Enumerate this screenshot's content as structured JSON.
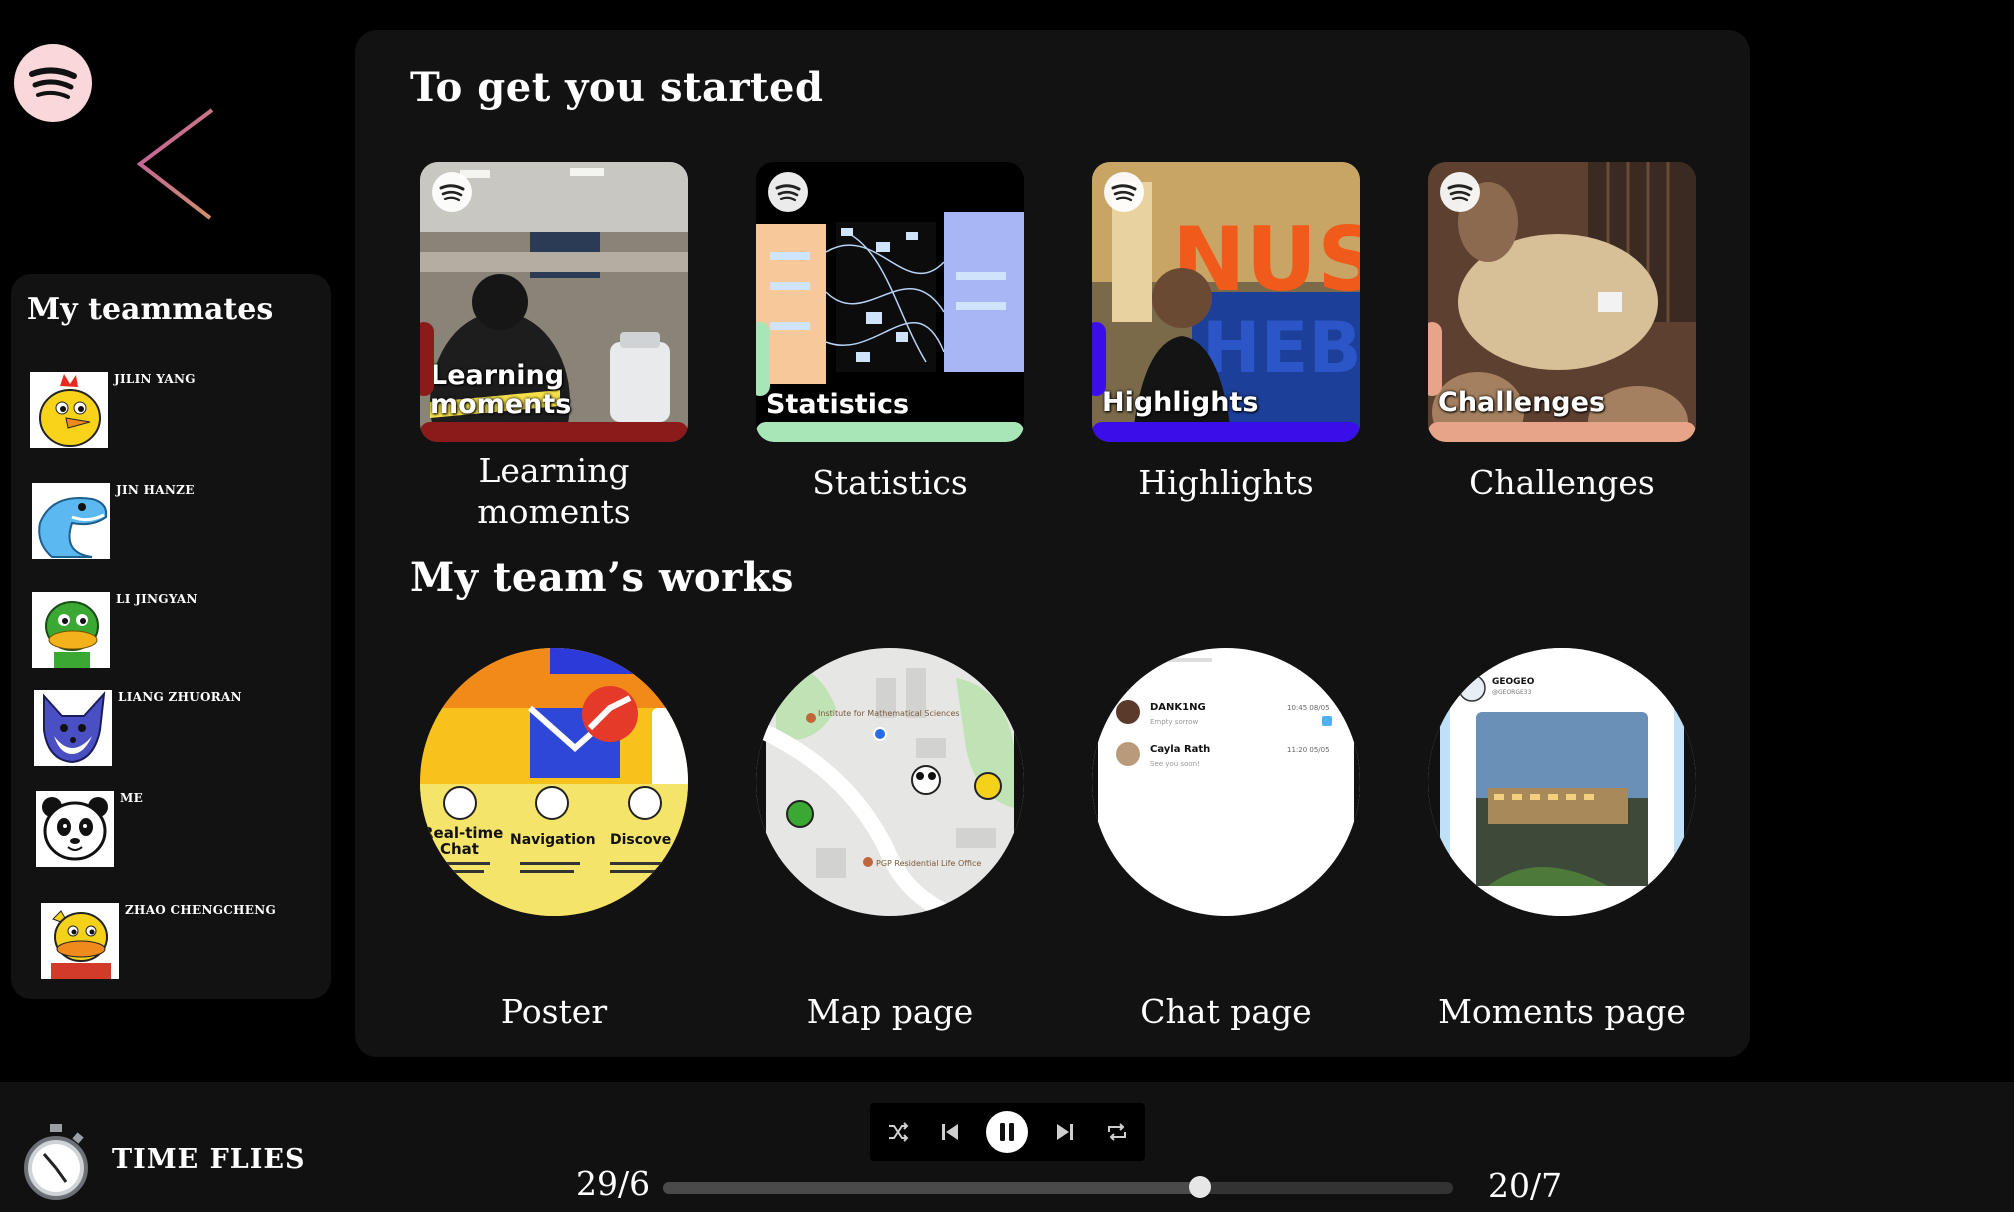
{
  "app": {
    "logo_icon": "spotify-icon"
  },
  "nav": {
    "back_icon": "chevron-left-icon"
  },
  "team": {
    "title": "My teammates",
    "members": [
      {
        "name": "JILIN YANG",
        "avatar_icon": "chick-avatar"
      },
      {
        "name": "JIN HANZE",
        "avatar_icon": "dolphin-avatar"
      },
      {
        "name": "LI JINGYAN",
        "avatar_icon": "duck-avatar"
      },
      {
        "name": "LIANG ZHUORAN",
        "avatar_icon": "fox-avatar"
      },
      {
        "name": "ME",
        "avatar_icon": "panda-avatar"
      },
      {
        "name": "ZHAO CHENGCHENG",
        "avatar_icon": "yellow-duck-avatar"
      }
    ]
  },
  "started": {
    "title": "To get you started",
    "cards": [
      {
        "overlay_line1": "Learning",
        "overlay_line2": "moments",
        "caption_line1": "Learning",
        "caption_line2": "moments",
        "accent": "#8b1a1a"
      },
      {
        "overlay_line1": "Statistics",
        "overlay_line2": "",
        "caption_line1": "Statistics",
        "caption_line2": "",
        "accent": "#a8e6b8"
      },
      {
        "overlay_line1": "Highlights",
        "overlay_line2": "",
        "caption_line1": "Highlights",
        "caption_line2": "",
        "accent": "#3a0ee8"
      },
      {
        "overlay_line1": "Challenges",
        "overlay_line2": "",
        "caption_line1": "Challenges",
        "caption_line2": "",
        "accent": "#e8a488"
      }
    ]
  },
  "works": {
    "title": "My team’s works",
    "items": [
      {
        "caption": "Poster"
      },
      {
        "caption": "Map page"
      },
      {
        "caption": "Chat page"
      },
      {
        "caption": "Moments page"
      }
    ]
  },
  "player": {
    "title": "TIME FLIES",
    "timer_icon": "stopwatch-icon",
    "start": "29/6",
    "end": "20/7",
    "progress": 0.68,
    "controls": [
      "shuffle-icon",
      "previous-icon",
      "pause-icon",
      "next-icon",
      "repeat-icon"
    ]
  },
  "thumbnail_text": {
    "poster_real_time": "Real-time",
    "poster_chat": "Chat",
    "poster_navigation": "Navigation",
    "poster_discover": "Discove",
    "map_label_1": "Institute for Mathematical Sciences",
    "map_label_2": "PGP Residential Life Office",
    "chat_user_1": "DANK1NG",
    "chat_msg_1": "Empty sorrow",
    "chat_time_1": "10:45 08/05",
    "chat_user_2": "Cayla Rath",
    "chat_msg_2": "See you soon!",
    "chat_time_2": "11:20 05/05",
    "moments_user": "GEOGEO",
    "moments_handle": "@GEORGE33"
  }
}
